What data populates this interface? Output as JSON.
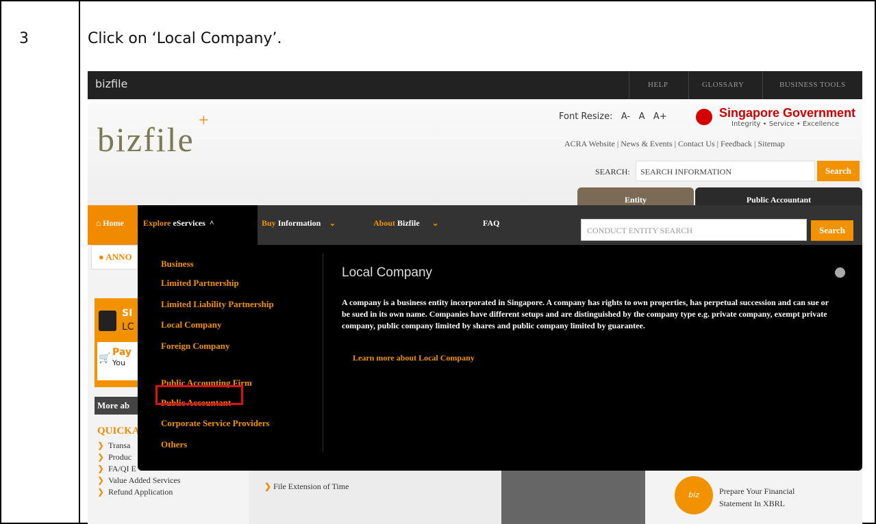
{
  "doc": {
    "step_number": "3",
    "instruction": "Click on ‘Local Company’."
  },
  "topbar": {
    "brand": "bizfile",
    "links": [
      "HELP",
      "GLOSSARY",
      "BUSINESS TOOLS"
    ]
  },
  "header": {
    "logo": "bizfile",
    "font_resize_label": "Font Resize:",
    "font_sizes": [
      "A-",
      "A",
      "A+"
    ],
    "gov_title_1": "Singapore",
    "gov_title_2": "Government",
    "gov_tagline": "Integrity • Service • Excellence",
    "links": [
      "ACRA Website",
      "News & Events",
      "Contact Us",
      "Feedback",
      "Sitemap"
    ],
    "search_label": "SEARCH:",
    "search_value": "SEARCH INFORMATION",
    "search_button": "Search"
  },
  "search_tabs": {
    "entity": "Entity",
    "public_accountant": "Public Accountant",
    "placeholder": "CONDUCT ENTITY SEARCH",
    "button": "Search"
  },
  "nav": {
    "home": "Home",
    "explore_1": "Explore",
    "explore_2": "eServices",
    "buy_1": "Buy",
    "buy_2": "Information",
    "about_1": "About",
    "about_2": "Bizfile",
    "faq": "FAQ"
  },
  "page_bits": {
    "announce": "ANNO",
    "signin_1": "SI",
    "signin_2": "LC",
    "pay": "Pay",
    "you": "You",
    "more_about": "More ab",
    "quick": "QUICKA",
    "quick_items": [
      "Transa",
      "Produc",
      "FA/QI E",
      "Value Added Services",
      "Refund Application"
    ],
    "file_extension": "File Extension of Time",
    "xbrl_badge": "biz",
    "xbrl_line1": "Prepare Your Financial",
    "xbrl_line2": "Statement In XBRL"
  },
  "mega_menu": {
    "items": [
      "Business",
      "Limited Partnership",
      "Limited Liability Partnership",
      "Local Company",
      "Foreign Company",
      "Public Accounting Firm",
      "Public Accountant",
      "Corporate Service Providers",
      "Others"
    ],
    "title": "Local Company",
    "description": "A company is a business entity incorporated in Singapore. A company has rights to own properties, has perpetual succession and can sue or be sued in its own name. Companies have different setups and are distinguished by the company type e.g. private company, exempt private company, public company limited by shares and public company limited by guarantee.",
    "learn_more": "Learn more about Local Company"
  },
  "colors": {
    "accent": "#f39200",
    "highlight": "#e01010"
  }
}
